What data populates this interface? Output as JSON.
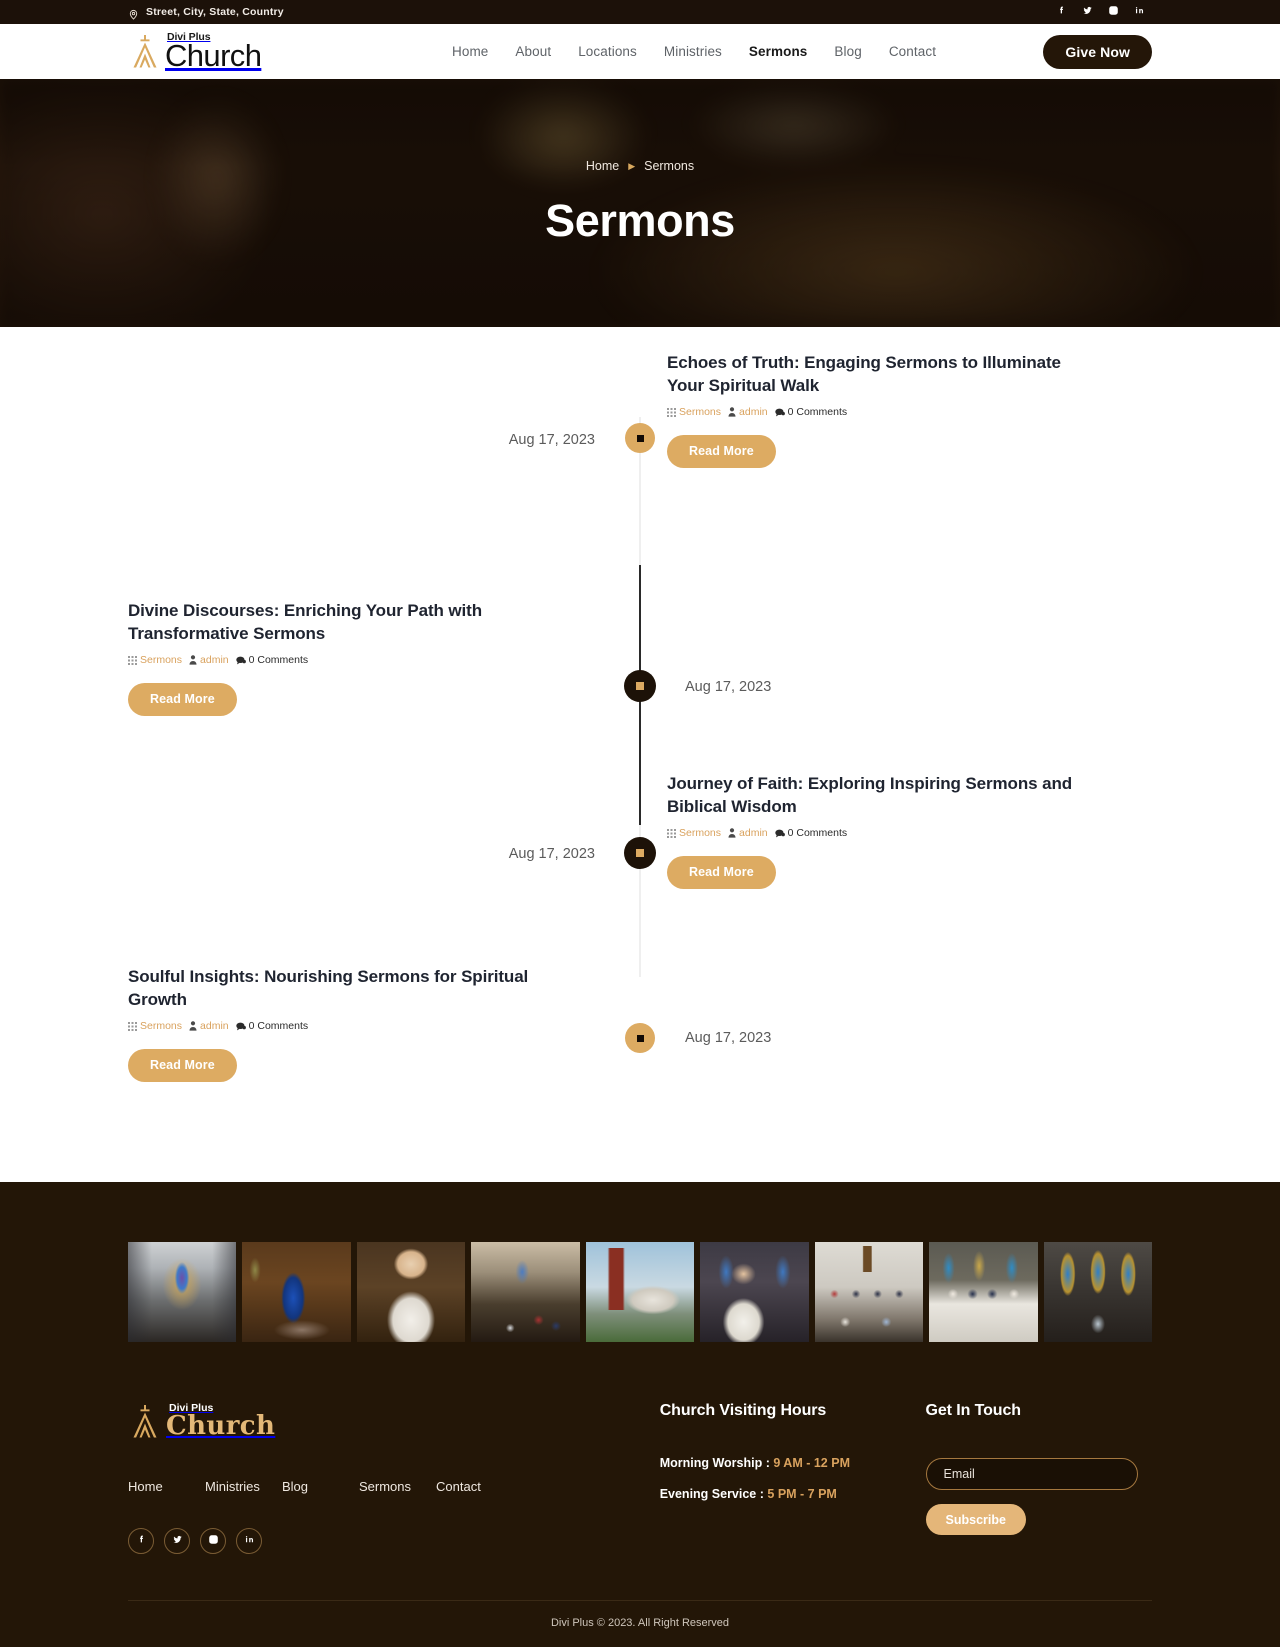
{
  "topbar": {
    "address": "Street, City, State, Country",
    "location_icon": "map-pin-icon",
    "social": [
      {
        "name": "facebook-icon",
        "label": "Facebook"
      },
      {
        "name": "twitter-icon",
        "label": "Twitter"
      },
      {
        "name": "instagram-icon",
        "label": "Instagram"
      },
      {
        "name": "linkedin-icon",
        "label": "LinkedIn"
      }
    ]
  },
  "header": {
    "logo_sup": "Divi Plus",
    "logo_main": "Church",
    "nav": [
      {
        "label": "Home",
        "active": false
      },
      {
        "label": "About",
        "active": false
      },
      {
        "label": "Locations",
        "active": false
      },
      {
        "label": "Ministries",
        "active": false
      },
      {
        "label": "Sermons",
        "active": true
      },
      {
        "label": "Blog",
        "active": false
      },
      {
        "label": "Contact",
        "active": false
      }
    ],
    "cta_label": "Give Now"
  },
  "hero": {
    "breadcrumb_home": "Home",
    "breadcrumb_sep": "▶",
    "breadcrumb_current": "Sermons",
    "title": "Sermons"
  },
  "timeline": {
    "posts": [
      {
        "date": "Aug 17, 2023",
        "title": "Echoes of Truth: Engaging Sermons to Illuminate Your Spiritual Walk",
        "category": "Sermons",
        "author": "admin",
        "comments": "0 Comments",
        "read_more": "Read More",
        "side": "right",
        "dot": "light"
      },
      {
        "date": "Aug 17, 2023",
        "title": "Divine Discourses: Enriching Your Path with Transformative Sermons",
        "category": "Sermons",
        "author": "admin",
        "comments": "0 Comments",
        "read_more": "Read More",
        "side": "left",
        "dot": "dark"
      },
      {
        "date": "Aug 17, 2023",
        "title": "Journey of Faith: Exploring Inspiring Sermons and Biblical Wisdom",
        "category": "Sermons",
        "author": "admin",
        "comments": "0 Comments",
        "read_more": "Read More",
        "side": "right",
        "dot": "dark"
      },
      {
        "date": "Aug 17, 2023",
        "title": "Soulful Insights: Nourishing Sermons for Spiritual Growth",
        "category": "Sermons",
        "author": "admin",
        "comments": "0 Comments",
        "read_more": "Read More",
        "side": "left",
        "dot": "light"
      }
    ]
  },
  "footer": {
    "gallery": [
      {
        "name": "gallery-cathedral-nave"
      },
      {
        "name": "gallery-preacher-blue-robe"
      },
      {
        "name": "gallery-woman-white-robe"
      },
      {
        "name": "gallery-congregation-seated"
      },
      {
        "name": "gallery-church-exterior-steeple"
      },
      {
        "name": "gallery-priest-with-cross"
      },
      {
        "name": "gallery-group-portrait-cross"
      },
      {
        "name": "gallery-wedding-party-table"
      },
      {
        "name": "gallery-stained-glass-pews"
      }
    ],
    "logo_sup": "Divi Plus",
    "logo_main": "Church",
    "links": [
      "Home",
      "Ministries",
      "Blog",
      "Sermons",
      "Contact"
    ],
    "social": [
      {
        "name": "facebook-icon",
        "label": "Facebook"
      },
      {
        "name": "twitter-icon",
        "label": "Twitter"
      },
      {
        "name": "instagram-icon",
        "label": "Instagram"
      },
      {
        "name": "linkedin-icon",
        "label": "LinkedIn"
      }
    ],
    "hours_heading": "Church Visiting Hours",
    "hours": [
      {
        "label": "Morning Worship :",
        "value": "9 AM - 12 PM"
      },
      {
        "label": "Evening Service :",
        "value": "5 PM - 7 PM"
      }
    ],
    "contact_heading": "Get In Touch",
    "email_placeholder": "Email",
    "email_value": "",
    "subscribe_label": "Subscribe",
    "copyright": "Divi Plus © 2023. All Right Reserved"
  },
  "colors": {
    "accent": "#ddab62",
    "dark": "#231607",
    "topbar": "#1c1109",
    "text_dark": "#1f2430"
  }
}
